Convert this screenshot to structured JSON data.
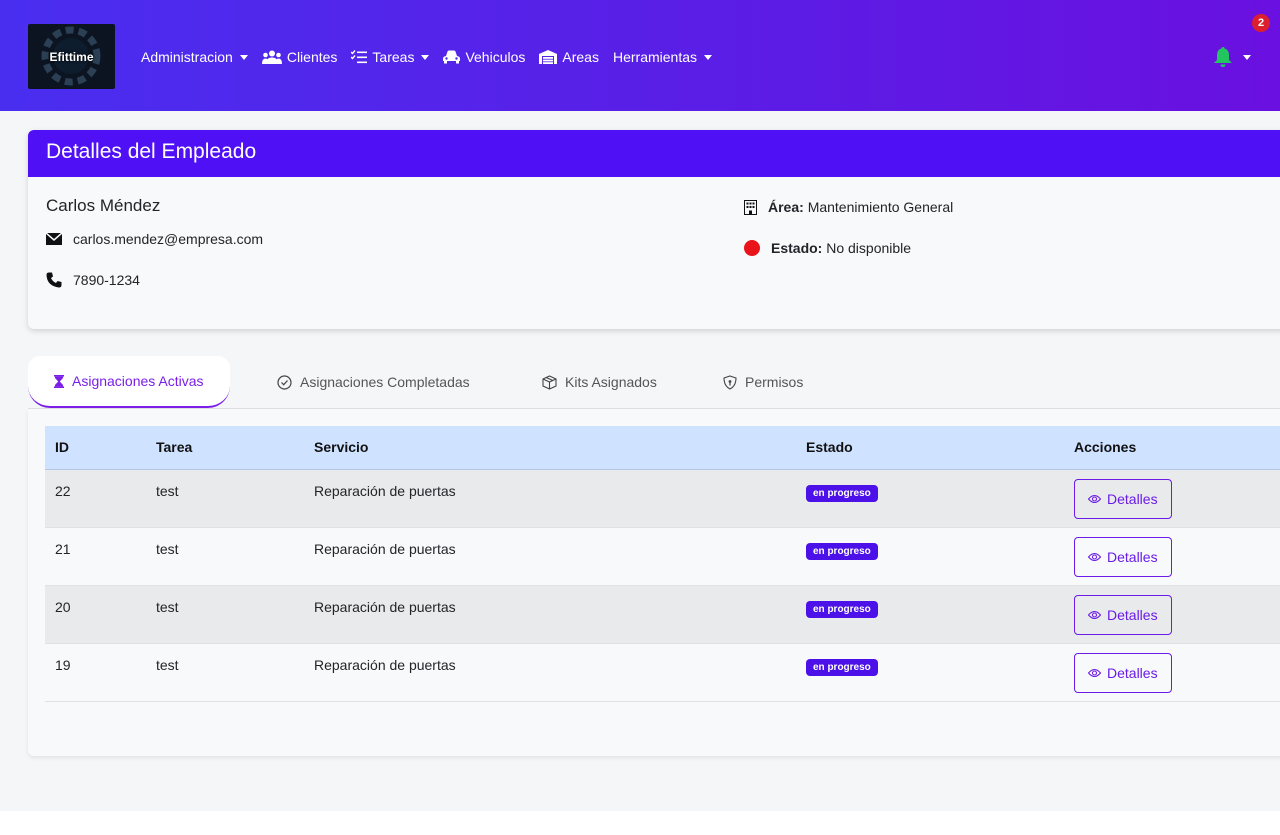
{
  "navbar": {
    "logo_text": "Efittime",
    "menu": [
      {
        "label": "Administracion",
        "icon": "",
        "dropdown": true
      },
      {
        "label": "Clientes",
        "icon": "users-icon",
        "dropdown": false
      },
      {
        "label": "Tareas",
        "icon": "list-check-icon",
        "dropdown": true
      },
      {
        "label": "Vehiculos",
        "icon": "car-icon",
        "dropdown": false
      },
      {
        "label": "Areas",
        "icon": "warehouse-icon",
        "dropdown": false
      },
      {
        "label": "Herramientas",
        "icon": "",
        "dropdown": true
      }
    ],
    "notification_count": "2",
    "bell_color": "#22c55e"
  },
  "employee": {
    "header_title": "Detalles del Empleado",
    "name": "Carlos Méndez",
    "email": "carlos.mendez@empresa.com",
    "phone": "7890-1234",
    "area_label": "Área:",
    "area_value": "Mantenimiento General",
    "status_label": "Estado:",
    "status_value": "No disponible",
    "status_color": "#e8141a"
  },
  "tabs": [
    {
      "label": "Asignaciones Activas",
      "icon": "hourglass-icon",
      "active": true
    },
    {
      "label": "Asignaciones Completadas",
      "icon": "check-circle-icon",
      "active": false
    },
    {
      "label": "Kits Asignados",
      "icon": "box-icon",
      "active": false
    },
    {
      "label": "Permisos",
      "icon": "shield-icon",
      "active": false
    }
  ],
  "table": {
    "headers": {
      "id": "ID",
      "tarea": "Tarea",
      "servicio": "Servicio",
      "estado": "Estado",
      "acciones": "Acciones"
    },
    "rows": [
      {
        "id": "22",
        "tarea": "test",
        "servicio": "Reparación de puertas",
        "estado": "en progreso",
        "accion": "Detalles"
      },
      {
        "id": "21",
        "tarea": "test",
        "servicio": "Reparación de puertas",
        "estado": "en progreso",
        "accion": "Detalles"
      },
      {
        "id": "20",
        "tarea": "test",
        "servicio": "Reparación de puertas",
        "estado": "en progreso",
        "accion": "Detalles"
      },
      {
        "id": "19",
        "tarea": "test",
        "servicio": "Reparación de puertas",
        "estado": "en progreso",
        "accion": "Detalles"
      }
    ]
  },
  "colors": {
    "primary": "#5010f5",
    "accent": "#7a1ee8",
    "table_header": "#cfe2ff"
  }
}
